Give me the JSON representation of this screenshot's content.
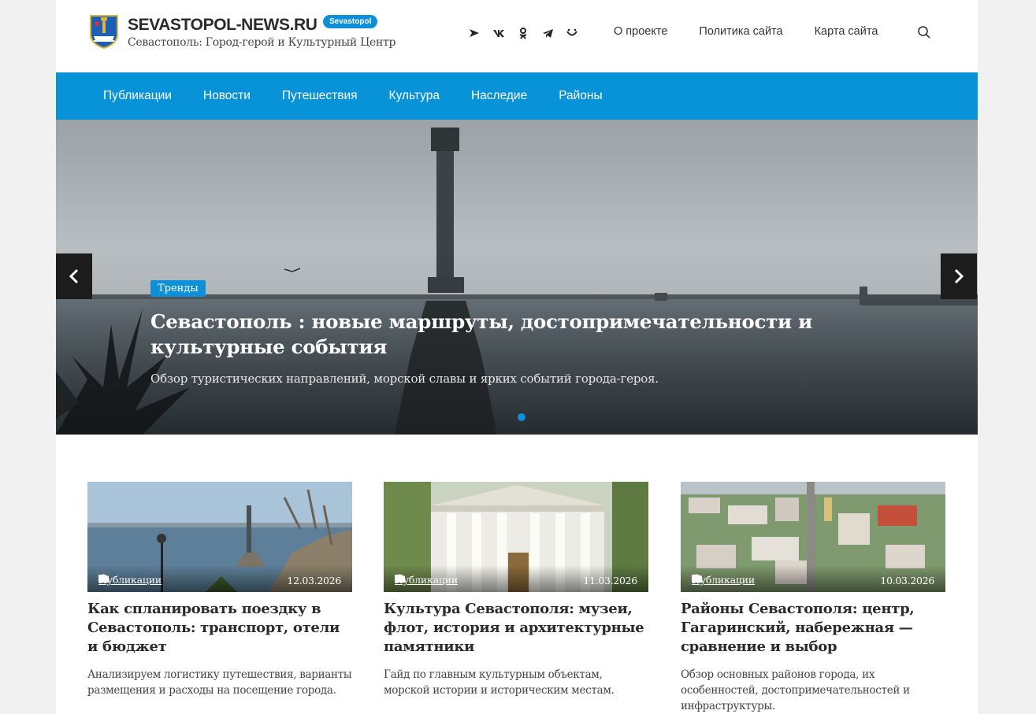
{
  "header": {
    "site_name": "SEVASTOPOL-NEWS.RU",
    "badge": "Sevastopol",
    "tagline": "Севастополь: Город-герой и Культурный Центр",
    "socials": [
      "yandex-zen-icon",
      "vk-icon",
      "odnoklassniki-icon",
      "telegram-icon",
      "max-icon"
    ],
    "links": [
      "О проекте",
      "Политика сайта",
      "Карта сайта"
    ]
  },
  "nav": {
    "items": [
      "Публикации",
      "Новости",
      "Путешествия",
      "Культура",
      "Наследие",
      "Районы"
    ]
  },
  "hero": {
    "category": "Тренды",
    "title": "Севастополь : новые маршруты, достопримечательности и культурные события",
    "description": "Обзор туристических направлений, морской славы и ярких событий города-героя."
  },
  "cards": [
    {
      "category": "Публикации",
      "date": "12.03.2026",
      "title": "Как спланировать поездку в Севастополь: транспорт, отели и бюджет",
      "excerpt": "Анализируем логистику путешествия, варианты размещения и расходы на посещение города."
    },
    {
      "category": "Публикации",
      "date": "11.03.2026",
      "title": "Культура Севастополя: музеи, флот, история и архитектурные памятники",
      "excerpt": "Гайд по главным культурным объектам, морской истории и историческим местам."
    },
    {
      "category": "Публикации",
      "date": "10.03.2026",
      "title": "Районы Севастополя: центр, Гагаринский, набережная — сравнение и выбор",
      "excerpt": "Обзор основных районов города, их особенностей, достопримечательностей и инфраструктуры."
    }
  ],
  "colors": {
    "accent": "#0893d9",
    "badge": "#0e8fd9",
    "background": "#f1f1f1"
  }
}
